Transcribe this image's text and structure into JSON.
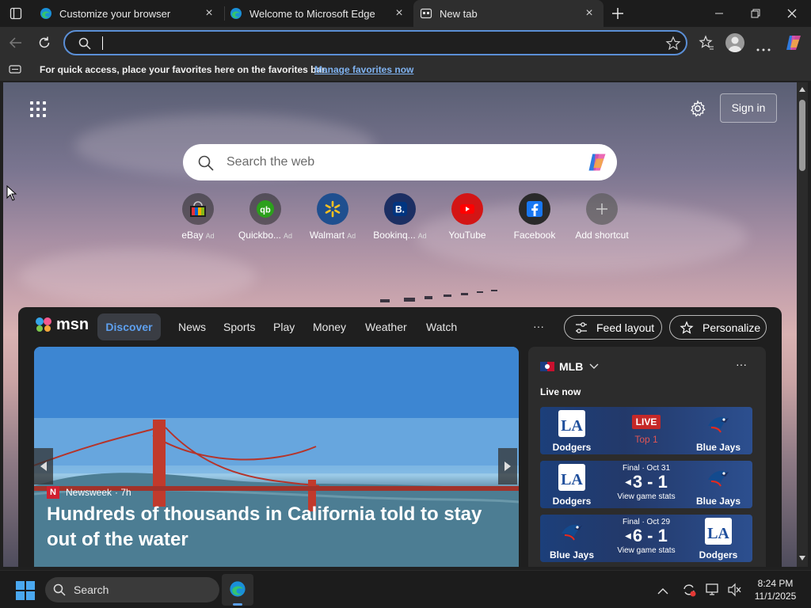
{
  "tabs": [
    {
      "title": "Customize your browser",
      "active": false
    },
    {
      "title": "Welcome to Microsoft Edge",
      "active": false
    },
    {
      "title": "New tab",
      "active": true
    }
  ],
  "address": {
    "value": "",
    "placeholder": ""
  },
  "favorites_bar": {
    "message": "For quick access, place your favorites here on the favorites bar.",
    "link": "Manage favorites now"
  },
  "page": {
    "sign_in": "Sign in",
    "search_placeholder": "Search the web",
    "shortcuts": [
      {
        "label": "eBay",
        "ad": "Ad"
      },
      {
        "label": "Quickbo...",
        "ad": "Ad"
      },
      {
        "label": "Walmart",
        "ad": "Ad"
      },
      {
        "label": "Bookinq...",
        "ad": "Ad"
      },
      {
        "label": "YouTube",
        "ad": ""
      },
      {
        "label": "Facebook",
        "ad": ""
      },
      {
        "label": "Add shortcut",
        "ad": ""
      }
    ]
  },
  "msn": {
    "brand": "msn",
    "nav": [
      "Discover",
      "News",
      "Sports",
      "Play",
      "Money",
      "Weather",
      "Watch"
    ],
    "more": "···",
    "feed_layout": "Feed layout",
    "personalize": "Personalize",
    "hero": {
      "source": "Newsweek",
      "age": "· 7h",
      "headline": "Hundreds of thousands in California told to stay out of the water"
    },
    "sports": {
      "league": "MLB",
      "section": "Live now",
      "more": "···",
      "games": [
        {
          "left": "Dodgers",
          "right": "Blue Jays",
          "status": "LIVE",
          "detail": "Top 1",
          "score": "",
          "link": ""
        },
        {
          "left": "Dodgers",
          "right": "Blue Jays",
          "status": "Final · Oct 31",
          "detail": "",
          "score": "3 - 1",
          "link": "View game stats"
        },
        {
          "left": "Blue Jays",
          "right": "Dodgers",
          "status": "Final · Oct 29",
          "detail": "",
          "score": "6 - 1",
          "link": "View game stats"
        }
      ]
    }
  },
  "taskbar": {
    "search": "Search",
    "time": "8:24 PM",
    "date": "11/1/2025"
  },
  "colors": {
    "accent": "#5b8fd6",
    "link": "#7fb2f0",
    "live": "#c62828"
  }
}
